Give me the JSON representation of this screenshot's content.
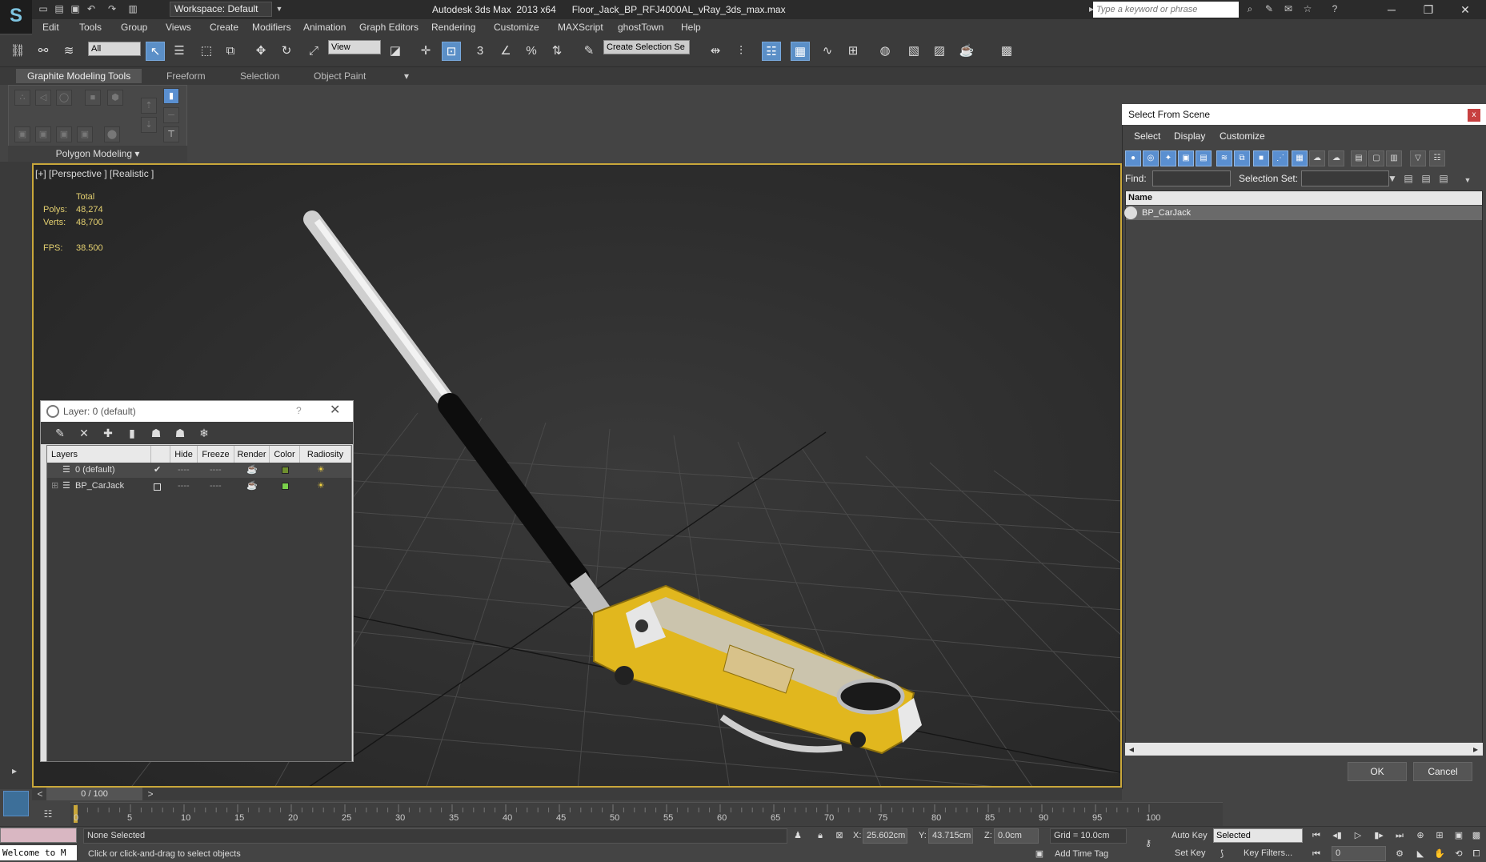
{
  "titlebar": {
    "logo": "S",
    "workspace": "Workspace: Default",
    "title": "Autodesk 3ds Max  2013 x64      Floor_Jack_BP_RFJ4000AL_vRay_3ds_max.max",
    "search_placeholder": "Type a keyword or phrase"
  },
  "menu": [
    "Edit",
    "Tools",
    "Group",
    "Views",
    "Create",
    "Modifiers",
    "Animation",
    "Graph Editors",
    "Rendering",
    "Customize",
    "MAXScript",
    "ghostTown",
    "Help"
  ],
  "toolbar": {
    "filter": "All",
    "reference": "View",
    "selection_set": "Create Selection Se"
  },
  "ribbon": {
    "tabs": [
      "Graphite Modeling Tools",
      "Freeform",
      "Selection",
      "Object Paint"
    ],
    "panel_label": "Polygon Modeling"
  },
  "viewport": {
    "label": "[+] [Perspective ] [Realistic ]",
    "stats": {
      "total_label": "Total",
      "polys_label": "Polys:",
      "polys": "48,274",
      "verts_label": "Verts:",
      "verts": "48,700",
      "fps_label": "FPS:",
      "fps": "38.500"
    }
  },
  "layer_dialog": {
    "title": "Layer: 0 (default)",
    "help": "?",
    "columns": [
      "Layers",
      "Hide",
      "Freeze",
      "Render",
      "Color",
      "Radiosity"
    ],
    "rows": [
      {
        "name": "0 (default)",
        "hide": "----",
        "freeze": "----",
        "color": "#6f8f2f",
        "current": true
      },
      {
        "name": "BP_CarJack",
        "hide": "----",
        "freeze": "----",
        "color": "#7ad04b",
        "current": false
      }
    ]
  },
  "select_from_scene": {
    "title": "Select From Scene",
    "menu": [
      "Select",
      "Display",
      "Customize"
    ],
    "find_label": "Find:",
    "selection_set_label": "Selection Set:",
    "name_header": "Name",
    "items": [
      "BP_CarJack"
    ],
    "ok": "OK",
    "cancel": "Cancel"
  },
  "timeline": {
    "frame": "0 / 100",
    "ticks": [
      "0",
      "5",
      "10",
      "15",
      "20",
      "25",
      "30",
      "35",
      "40",
      "45",
      "50",
      "55",
      "60",
      "65",
      "70",
      "75",
      "80",
      "85",
      "90",
      "95",
      "100"
    ]
  },
  "status": {
    "maxscript": "Welcome to M",
    "selection": "None Selected",
    "prompt": "Click or click-and-drag to select objects",
    "x_label": "X:",
    "x": "25.602cm",
    "y_label": "Y:",
    "y": "43.715cm",
    "z_label": "Z:",
    "z": "0.0cm",
    "grid": "Grid = 10.0cm",
    "add_time_tag": "Add Time Tag",
    "auto_key": "Auto Key",
    "set_key": "Set Key",
    "key_mode": "Selected",
    "key_filters": "Key Filters...",
    "frame_field": "0"
  }
}
